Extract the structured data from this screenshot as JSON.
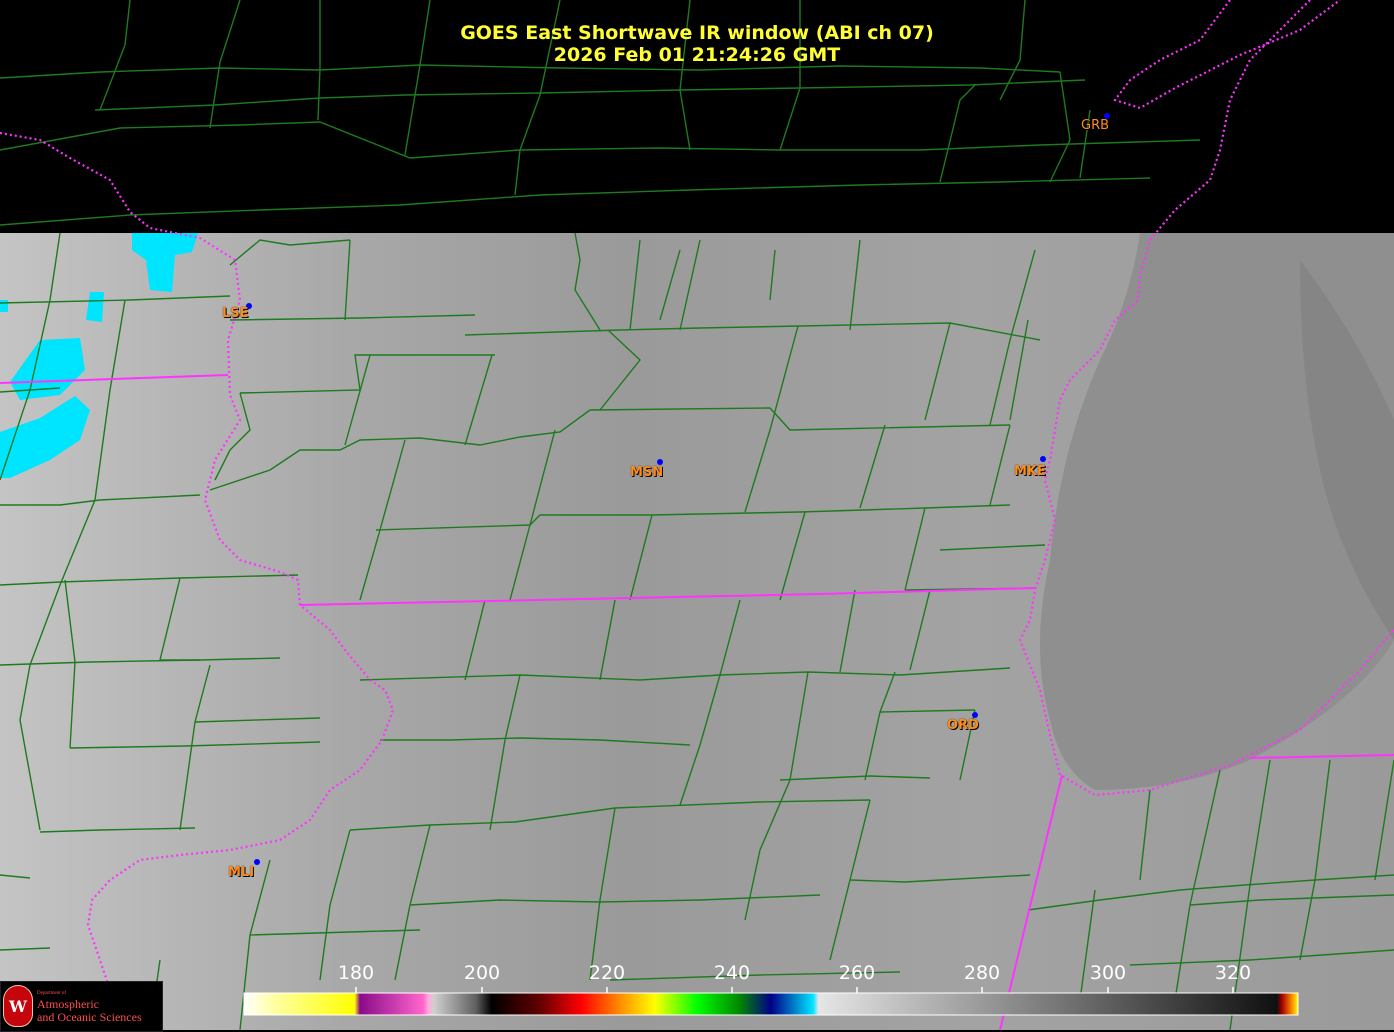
{
  "title": {
    "line1": "GOES East Shortwave IR window (ABI ch 07)",
    "line2": "2026 Feb 01  21:24:26 GMT"
  },
  "stations": [
    {
      "code": "GRB"
    },
    {
      "code": "LSE"
    },
    {
      "code": "MSN"
    },
    {
      "code": "MKE"
    },
    {
      "code": "ORD"
    },
    {
      "code": "MLI"
    }
  ],
  "colorbar": {
    "ticks": [
      "180",
      "200",
      "220",
      "240",
      "260",
      "280",
      "300",
      "320"
    ]
  },
  "logo": {
    "dept": "Department of",
    "line1": "Atmospheric",
    "line2": "and Oceanic Sciences"
  },
  "colors": {
    "title": "#ffff33",
    "station_label": "#ff8c1a",
    "county_lines": "#1f7a1f",
    "state_lines": "#ff33ff",
    "cold_cloud": "#00e5ff"
  }
}
